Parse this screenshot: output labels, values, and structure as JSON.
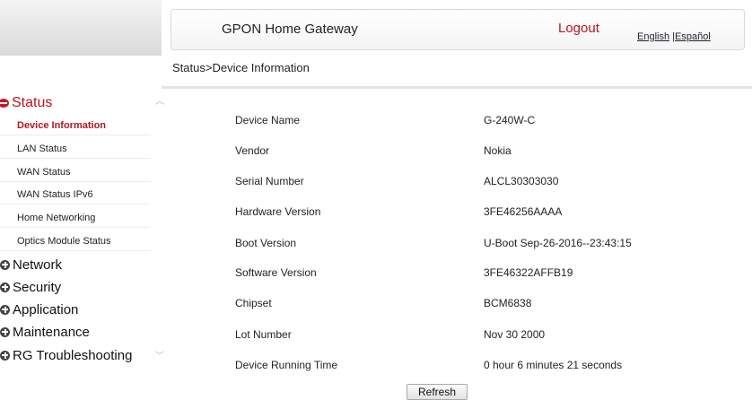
{
  "header": {
    "title": "GPON Home Gateway",
    "logout": "Logout",
    "lang_english": "English",
    "lang_sep": " |",
    "lang_spanish": "Español"
  },
  "breadcrumb": "Status>Device Information",
  "sidebar": {
    "status_label": "Status",
    "status_items": [
      {
        "label": "Device Information",
        "active": true
      },
      {
        "label": "LAN Status"
      },
      {
        "label": "WAN Status"
      },
      {
        "label": "WAN Status IPv6"
      },
      {
        "label": "Home Networking"
      },
      {
        "label": "Optics Module Status"
      }
    ],
    "groups": [
      "Network",
      "Security",
      "Application",
      "Maintenance",
      "RG Troubleshooting"
    ]
  },
  "device_info": [
    {
      "label": "Device Name",
      "value": "G-240W-C"
    },
    {
      "label": "Vendor",
      "value": "Nokia"
    },
    {
      "label": "Serial Number",
      "value": "ALCL30303030"
    },
    {
      "label": "Hardware Version",
      "value": "3FE46256AAAA"
    },
    {
      "label": "Boot Version",
      "value": "U-Boot Sep-26-2016--23:43:15"
    },
    {
      "label": "Software Version",
      "value": "3FE46322AFFB19"
    },
    {
      "label": "Chipset",
      "value": "BCM6838"
    },
    {
      "label": "Lot Number",
      "value": "Nov 30 2000"
    },
    {
      "label": "Device Running Time",
      "value": "0 hour 6 minutes 21 seconds"
    }
  ],
  "refresh_label": "Refresh",
  "colors": {
    "accent": "#b8141d"
  }
}
